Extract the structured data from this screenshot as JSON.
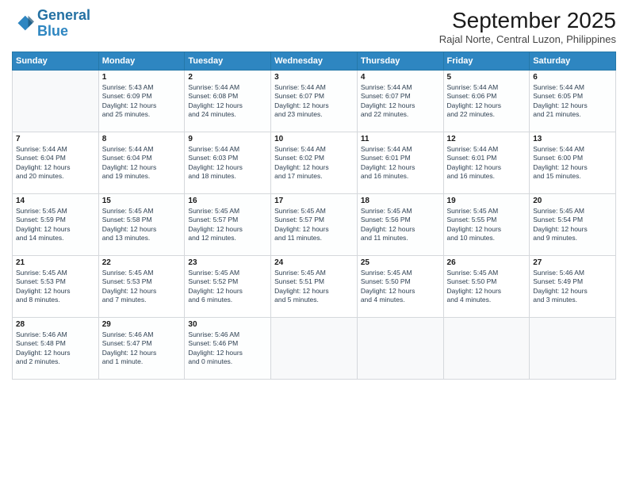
{
  "logo": {
    "line1": "General",
    "line2": "Blue"
  },
  "title": "September 2025",
  "subtitle": "Rajal Norte, Central Luzon, Philippines",
  "days_header": [
    "Sunday",
    "Monday",
    "Tuesday",
    "Wednesday",
    "Thursday",
    "Friday",
    "Saturday"
  ],
  "weeks": [
    [
      {
        "day": "",
        "info": ""
      },
      {
        "day": "1",
        "info": "Sunrise: 5:43 AM\nSunset: 6:09 PM\nDaylight: 12 hours\nand 25 minutes."
      },
      {
        "day": "2",
        "info": "Sunrise: 5:44 AM\nSunset: 6:08 PM\nDaylight: 12 hours\nand 24 minutes."
      },
      {
        "day": "3",
        "info": "Sunrise: 5:44 AM\nSunset: 6:07 PM\nDaylight: 12 hours\nand 23 minutes."
      },
      {
        "day": "4",
        "info": "Sunrise: 5:44 AM\nSunset: 6:07 PM\nDaylight: 12 hours\nand 22 minutes."
      },
      {
        "day": "5",
        "info": "Sunrise: 5:44 AM\nSunset: 6:06 PM\nDaylight: 12 hours\nand 22 minutes."
      },
      {
        "day": "6",
        "info": "Sunrise: 5:44 AM\nSunset: 6:05 PM\nDaylight: 12 hours\nand 21 minutes."
      }
    ],
    [
      {
        "day": "7",
        "info": "Sunrise: 5:44 AM\nSunset: 6:04 PM\nDaylight: 12 hours\nand 20 minutes."
      },
      {
        "day": "8",
        "info": "Sunrise: 5:44 AM\nSunset: 6:04 PM\nDaylight: 12 hours\nand 19 minutes."
      },
      {
        "day": "9",
        "info": "Sunrise: 5:44 AM\nSunset: 6:03 PM\nDaylight: 12 hours\nand 18 minutes."
      },
      {
        "day": "10",
        "info": "Sunrise: 5:44 AM\nSunset: 6:02 PM\nDaylight: 12 hours\nand 17 minutes."
      },
      {
        "day": "11",
        "info": "Sunrise: 5:44 AM\nSunset: 6:01 PM\nDaylight: 12 hours\nand 16 minutes."
      },
      {
        "day": "12",
        "info": "Sunrise: 5:44 AM\nSunset: 6:01 PM\nDaylight: 12 hours\nand 16 minutes."
      },
      {
        "day": "13",
        "info": "Sunrise: 5:44 AM\nSunset: 6:00 PM\nDaylight: 12 hours\nand 15 minutes."
      }
    ],
    [
      {
        "day": "14",
        "info": "Sunrise: 5:45 AM\nSunset: 5:59 PM\nDaylight: 12 hours\nand 14 minutes."
      },
      {
        "day": "15",
        "info": "Sunrise: 5:45 AM\nSunset: 5:58 PM\nDaylight: 12 hours\nand 13 minutes."
      },
      {
        "day": "16",
        "info": "Sunrise: 5:45 AM\nSunset: 5:57 PM\nDaylight: 12 hours\nand 12 minutes."
      },
      {
        "day": "17",
        "info": "Sunrise: 5:45 AM\nSunset: 5:57 PM\nDaylight: 12 hours\nand 11 minutes."
      },
      {
        "day": "18",
        "info": "Sunrise: 5:45 AM\nSunset: 5:56 PM\nDaylight: 12 hours\nand 11 minutes."
      },
      {
        "day": "19",
        "info": "Sunrise: 5:45 AM\nSunset: 5:55 PM\nDaylight: 12 hours\nand 10 minutes."
      },
      {
        "day": "20",
        "info": "Sunrise: 5:45 AM\nSunset: 5:54 PM\nDaylight: 12 hours\nand 9 minutes."
      }
    ],
    [
      {
        "day": "21",
        "info": "Sunrise: 5:45 AM\nSunset: 5:53 PM\nDaylight: 12 hours\nand 8 minutes."
      },
      {
        "day": "22",
        "info": "Sunrise: 5:45 AM\nSunset: 5:53 PM\nDaylight: 12 hours\nand 7 minutes."
      },
      {
        "day": "23",
        "info": "Sunrise: 5:45 AM\nSunset: 5:52 PM\nDaylight: 12 hours\nand 6 minutes."
      },
      {
        "day": "24",
        "info": "Sunrise: 5:45 AM\nSunset: 5:51 PM\nDaylight: 12 hours\nand 5 minutes."
      },
      {
        "day": "25",
        "info": "Sunrise: 5:45 AM\nSunset: 5:50 PM\nDaylight: 12 hours\nand 4 minutes."
      },
      {
        "day": "26",
        "info": "Sunrise: 5:45 AM\nSunset: 5:50 PM\nDaylight: 12 hours\nand 4 minutes."
      },
      {
        "day": "27",
        "info": "Sunrise: 5:46 AM\nSunset: 5:49 PM\nDaylight: 12 hours\nand 3 minutes."
      }
    ],
    [
      {
        "day": "28",
        "info": "Sunrise: 5:46 AM\nSunset: 5:48 PM\nDaylight: 12 hours\nand 2 minutes."
      },
      {
        "day": "29",
        "info": "Sunrise: 5:46 AM\nSunset: 5:47 PM\nDaylight: 12 hours\nand 1 minute."
      },
      {
        "day": "30",
        "info": "Sunrise: 5:46 AM\nSunset: 5:46 PM\nDaylight: 12 hours\nand 0 minutes."
      },
      {
        "day": "",
        "info": ""
      },
      {
        "day": "",
        "info": ""
      },
      {
        "day": "",
        "info": ""
      },
      {
        "day": "",
        "info": ""
      }
    ]
  ]
}
